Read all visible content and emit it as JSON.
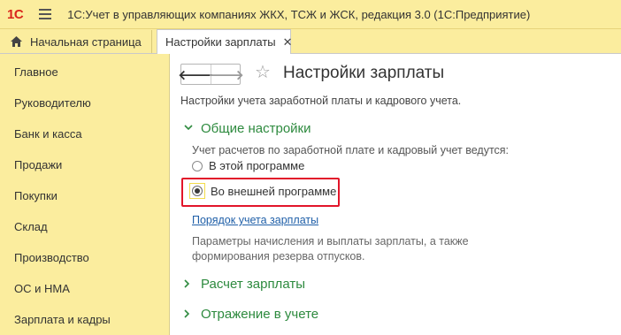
{
  "titlebar": {
    "logo": "1С",
    "app_title": "1С:Учет в управляющих компаниях ЖКХ, ТСЖ и ЖСК, редакция 3.0  (1С:Предприятие)"
  },
  "tabs": {
    "home_label": "Начальная страница",
    "active_label": "Настройки зарплаты",
    "close_glyph": "✕"
  },
  "sidebar": {
    "items": [
      {
        "label": "Главное"
      },
      {
        "label": "Руководителю"
      },
      {
        "label": "Банк и касса"
      },
      {
        "label": "Продажи"
      },
      {
        "label": "Покупки"
      },
      {
        "label": "Склад"
      },
      {
        "label": "Производство"
      },
      {
        "label": "ОС и НМА"
      },
      {
        "label": "Зарплата и кадры"
      }
    ]
  },
  "main": {
    "back_glyph": "🡐",
    "forward_glyph": "🡒",
    "star_glyph": "☆",
    "title": "Настройки зарплаты",
    "subtitle": "Настройки учета заработной платы и кадрового учета.",
    "general": {
      "heading": "Общие настройки",
      "chevron": "⌄",
      "description": "Учет расчетов по заработной плате и кадровый учет ведутся:",
      "options": [
        {
          "label": "В этой программе",
          "selected": false
        },
        {
          "label": "Во внешней программе",
          "selected": true
        }
      ],
      "link": "Порядок учета зарплаты",
      "note_line1": "Параметры начисления и выплаты зарплаты, а также",
      "note_line2": "формирования резерва отпусков."
    },
    "payroll": {
      "heading": "Расчет зарплаты",
      "chevron": "›"
    },
    "accounting": {
      "heading": "Отражение в учете",
      "chevron": "›"
    }
  },
  "colors": {
    "panel_yellow": "#fbed9e",
    "section_green": "#2d8a3e",
    "link_blue": "#1f5fa8",
    "highlight_red": "#e2152a"
  }
}
